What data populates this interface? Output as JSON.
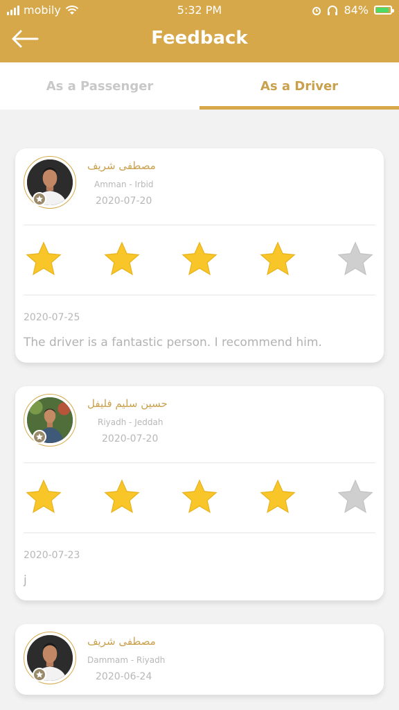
{
  "status_bar": {
    "carrier": "mobily",
    "time": "5:32 PM",
    "battery": "84%"
  },
  "header": {
    "title": "Feedback",
    "back_icon": "arrow-left-icon",
    "background": "#d6a84a"
  },
  "tabs": [
    {
      "label": "As a Passenger",
      "active": false
    },
    {
      "label": "As a Driver",
      "active": true
    }
  ],
  "colors": {
    "accent": "#d6a84a",
    "star_filled": "#f9c62a",
    "star_empty": "#cfcfcf"
  },
  "feedback": [
    {
      "name": "مصطفى شريف",
      "route": "Amman - Irbid",
      "trip_date": "2020-07-20",
      "rating": 4,
      "review_date": "2020-07-25",
      "comment": "The driver is a fantastic person. I recommend him."
    },
    {
      "name": "حسين سليم فليفل",
      "route": "Riyadh - Jeddah",
      "trip_date": "2020-07-20",
      "rating": 4,
      "review_date": "2020-07-23",
      "comment": "j"
    },
    {
      "name": "مصطفى شريف",
      "route": "Dammam - Riyadh",
      "trip_date": "2020-06-24"
    }
  ]
}
